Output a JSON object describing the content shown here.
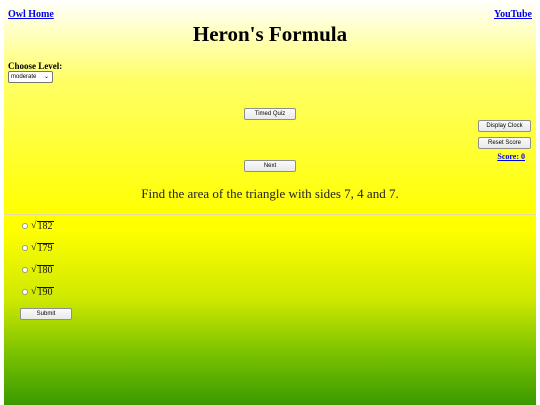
{
  "links": {
    "owl_home": "Owl Home",
    "youtube": "YouTube"
  },
  "title": "Heron's Formula",
  "level": {
    "label": "Choose Level:",
    "selected": "moderate"
  },
  "buttons": {
    "timed_quiz": "Timed Quiz",
    "display_clock": "Display Clock",
    "reset_score": "Reset Score",
    "next": "Next",
    "submit": "Submit"
  },
  "score": {
    "label": "Score:",
    "value": "0"
  },
  "question": "Find the area of the triangle with sides 7, 4 and 7.",
  "options": [
    {
      "radicand": "182"
    },
    {
      "radicand": "179"
    },
    {
      "radicand": "180"
    },
    {
      "radicand": "190"
    }
  ],
  "icons": {
    "radical": "√",
    "dropdown": "chevron-down-icon"
  }
}
